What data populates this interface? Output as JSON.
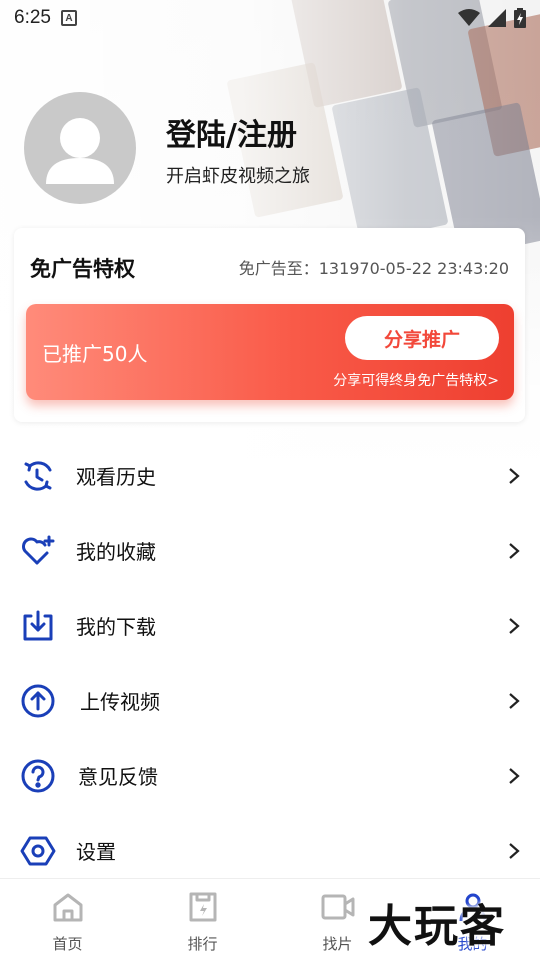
{
  "status_bar": {
    "time": "6:25",
    "notification_icon": "a-icon",
    "icons": [
      "wifi-icon",
      "signal-icon",
      "battery-icon"
    ]
  },
  "profile": {
    "title": "登陆/注册",
    "subtitle": "开启虾皮视频之旅"
  },
  "ad_card": {
    "title": "免广告特权",
    "expiry": "免广告至：131970-05-22 23:43:20",
    "promoted_count": "已推广50人",
    "share_button": "分享推广",
    "hint": "分享可得终身免广告特权>"
  },
  "menu": [
    {
      "label": "观看历史",
      "icon": "history-icon"
    },
    {
      "label": "我的收藏",
      "icon": "favorite-heart-icon"
    },
    {
      "label": "我的下载",
      "icon": "download-icon"
    },
    {
      "label": "上传视频",
      "icon": "upload-icon"
    },
    {
      "label": "意见反馈",
      "icon": "feedback-question-icon"
    },
    {
      "label": "设置",
      "icon": "settings-hexagon-icon"
    }
  ],
  "bottom_nav": [
    {
      "label": "首页",
      "icon": "home-icon",
      "active": false
    },
    {
      "label": "排行",
      "icon": "ranking-icon",
      "active": false
    },
    {
      "label": "找片",
      "icon": "video-camera-icon",
      "active": false
    },
    {
      "label": "我的",
      "icon": "profile-icon",
      "active": true
    }
  ],
  "watermark": "大玩客",
  "colors": {
    "accent_blue": "#2244cc",
    "promo_red": "#f2483a",
    "avatar_gray": "#c9c9c9"
  }
}
